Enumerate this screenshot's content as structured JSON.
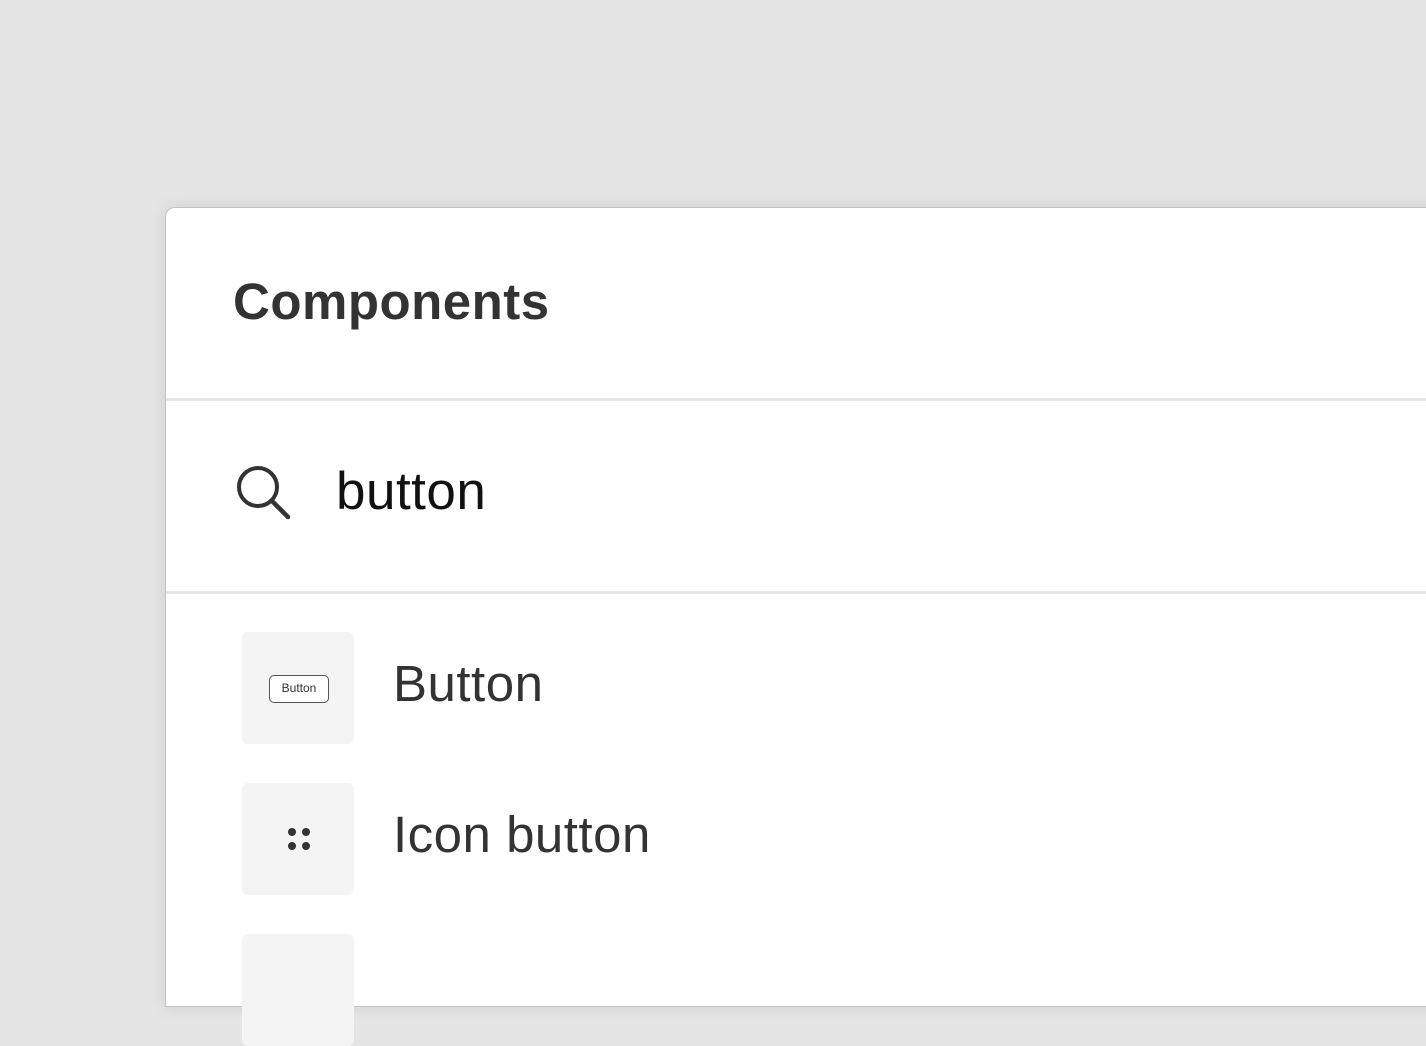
{
  "panel": {
    "title": "Components"
  },
  "search": {
    "value": "button",
    "icon": "search-icon"
  },
  "results": [
    {
      "label": "Button",
      "thumb_label": "Button",
      "icon": "button-preview"
    },
    {
      "label": "Icon button",
      "icon": "four-dots-icon"
    },
    {
      "label": "",
      "icon": "partial-thumbnail"
    }
  ],
  "colors": {
    "background": "#e5e5e5",
    "panel": "#ffffff",
    "thumbnail": "#f4f4f4",
    "text": "#333333"
  }
}
